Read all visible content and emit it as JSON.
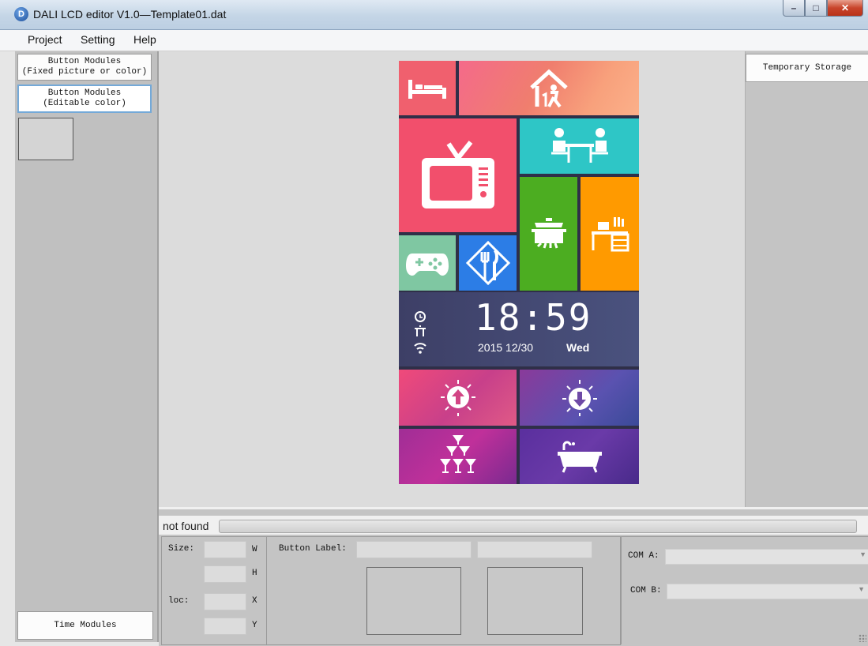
{
  "window": {
    "title": "DALI LCD editor V1.0—Template01.dat",
    "app_icon": "D"
  },
  "menu": {
    "items": [
      "Project",
      "Setting",
      "Help"
    ]
  },
  "left_panel": {
    "button_fixed": {
      "line1": "Button Modules",
      "line2": "(Fixed picture or color)"
    },
    "button_editable": {
      "line1": "Button Modules",
      "line2": "(Editable color)"
    },
    "time_modules": "Time Modules"
  },
  "right_panel": {
    "temporary_storage": "Temporary Storage"
  },
  "status": {
    "text": "not found"
  },
  "properties": {
    "size_label": "Size:",
    "w_label": "W",
    "h_label": "H",
    "loc_label": "loc:",
    "x_label": "X",
    "y_label": "Y",
    "button_label": "Button Label:",
    "com_a_label": "COM A:",
    "com_b_label": "COM B:"
  },
  "lcd": {
    "time": "18:59",
    "date": "2015  12/30",
    "day": "Wed",
    "tiles": [
      {
        "icon": "bed-icon",
        "color": "#f0606e"
      },
      {
        "icon": "home-person-icon",
        "color": "#f27770"
      },
      {
        "icon": "tv-icon",
        "color": "#f24f6c"
      },
      {
        "icon": "dining-table-icon",
        "color": "#2ec6c6"
      },
      {
        "icon": "cooking-pot-icon",
        "color": "#4cad21"
      },
      {
        "icon": "study-desk-icon",
        "color": "#ff9a00"
      },
      {
        "icon": "gamepad-icon",
        "color": "#7fc7a2"
      },
      {
        "icon": "fork-knife-icon",
        "color": "#2c7de6"
      },
      {
        "icon": "light-up-icon",
        "color": "#d24585"
      },
      {
        "icon": "light-down-icon",
        "color": "#6e4aa6"
      },
      {
        "icon": "glass-tower-icon",
        "color": "#b0309a"
      },
      {
        "icon": "bathtub-icon",
        "color": "#5a2f9e"
      }
    ]
  }
}
